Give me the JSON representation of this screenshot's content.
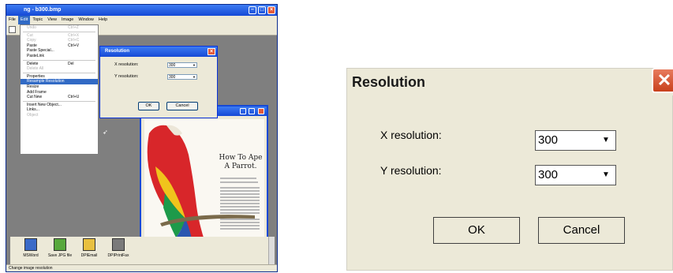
{
  "app": {
    "title": "ng - b300.bmp",
    "menubar": [
      "File",
      "Edit",
      "Topic",
      "View",
      "Image",
      "Window",
      "Help"
    ],
    "edit_menu": [
      {
        "label": "Undo",
        "shortcut": "Ctrl+Z",
        "disabled": true
      },
      {
        "sep": true
      },
      {
        "label": "Cut",
        "shortcut": "Ctrl+X",
        "disabled": true
      },
      {
        "label": "Copy",
        "shortcut": "Ctrl+C",
        "disabled": true
      },
      {
        "label": "Paste",
        "shortcut": "Ctrl+V",
        "disabled": false
      },
      {
        "label": "Paste Special...",
        "shortcut": "",
        "disabled": false
      },
      {
        "label": "PasteLink",
        "shortcut": "",
        "disabled": false
      },
      {
        "sep": true
      },
      {
        "label": "Delete",
        "shortcut": "Del",
        "disabled": false
      },
      {
        "label": "Delete All",
        "shortcut": "",
        "disabled": true
      },
      {
        "sep": true
      },
      {
        "label": "Properties",
        "shortcut": "",
        "disabled": false
      },
      {
        "label": "Resample Resolution",
        "shortcut": "",
        "disabled": false,
        "selected": true
      },
      {
        "label": "Resize",
        "shortcut": "",
        "disabled": false
      },
      {
        "label": "Add Frame",
        "shortcut": "",
        "disabled": false
      },
      {
        "label": "Cut New",
        "shortcut": "Ctrl+U",
        "disabled": false
      },
      {
        "sep": true
      },
      {
        "label": "Insert New Object...",
        "shortcut": "",
        "disabled": false
      },
      {
        "label": "Links...",
        "shortcut": "",
        "disabled": false
      },
      {
        "label": "Object",
        "shortcut": "",
        "disabled": true
      }
    ],
    "page_title": "How To Ape A Parrot.",
    "shortcuts": [
      "MSWord",
      "Save JPG file",
      "DPIEmail",
      "DPIPrintFax"
    ],
    "status": "Change image resolution"
  },
  "dialog": {
    "title": "Resolution",
    "close_glyph": "✕",
    "x_label": "X resolution:",
    "x_value": "300",
    "y_label": "Y resolution:",
    "y_value": "300",
    "ok_label": "OK",
    "cancel_label": "Cancel",
    "dropdown_glyph": "▼"
  }
}
